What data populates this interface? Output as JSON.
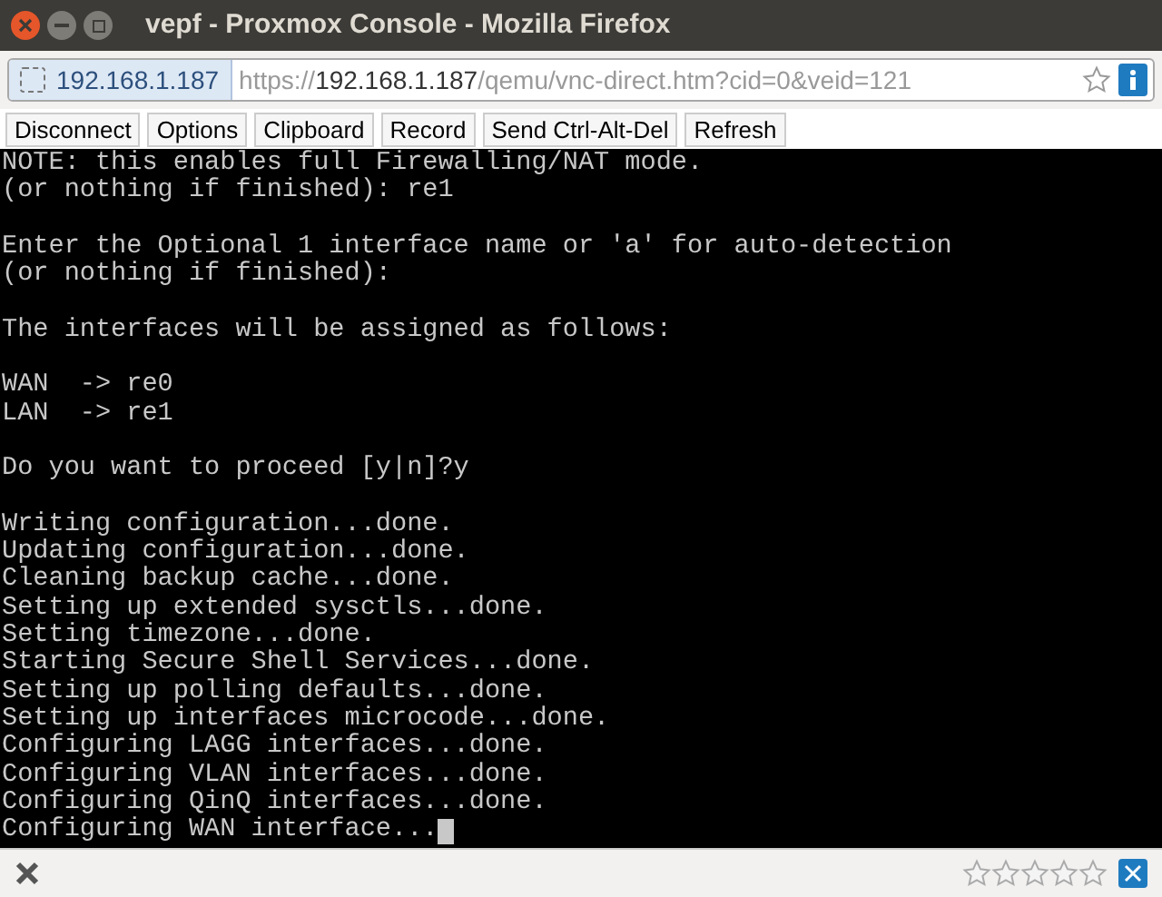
{
  "window": {
    "title": "vepf - Proxmox Console - Mozilla Firefox"
  },
  "address_bar": {
    "site": "192.168.1.187",
    "url_prefix": "https://",
    "url_host": "192.168.1.187",
    "url_path": "/qemu/vnc-direct.htm?cid=0&veid=121"
  },
  "toolbar": {
    "buttons": [
      "Disconnect",
      "Options",
      "Clipboard",
      "Record",
      "Send Ctrl-Alt-Del",
      "Refresh"
    ]
  },
  "console": {
    "blocks": [
      [
        "NOTE: this enables full Firewalling/NAT mode.",
        "(or nothing if finished): re1"
      ],
      [
        "Enter the Optional 1 interface name or 'a' for auto-detection",
        "(or nothing if finished):"
      ],
      [
        "The interfaces will be assigned as follows:"
      ],
      [
        "WAN  -> re0",
        "LAN  -> re1"
      ],
      [
        "Do you want to proceed [y|n]?y"
      ],
      [
        "Writing configuration...done.",
        "Updating configuration...done.",
        "Cleaning backup cache...done.",
        "Setting up extended sysctls...done.",
        "Setting timezone...done.",
        "Starting Secure Shell Services...done.",
        "Setting up polling defaults...done.",
        "Setting up interfaces microcode...done.",
        "Configuring LAGG interfaces...done.",
        "Configuring VLAN interfaces...done.",
        "Configuring QinQ interfaces...done.",
        "Configuring WAN interface..."
      ]
    ],
    "cursor": true
  },
  "status_bar": {
    "stars": 0
  }
}
